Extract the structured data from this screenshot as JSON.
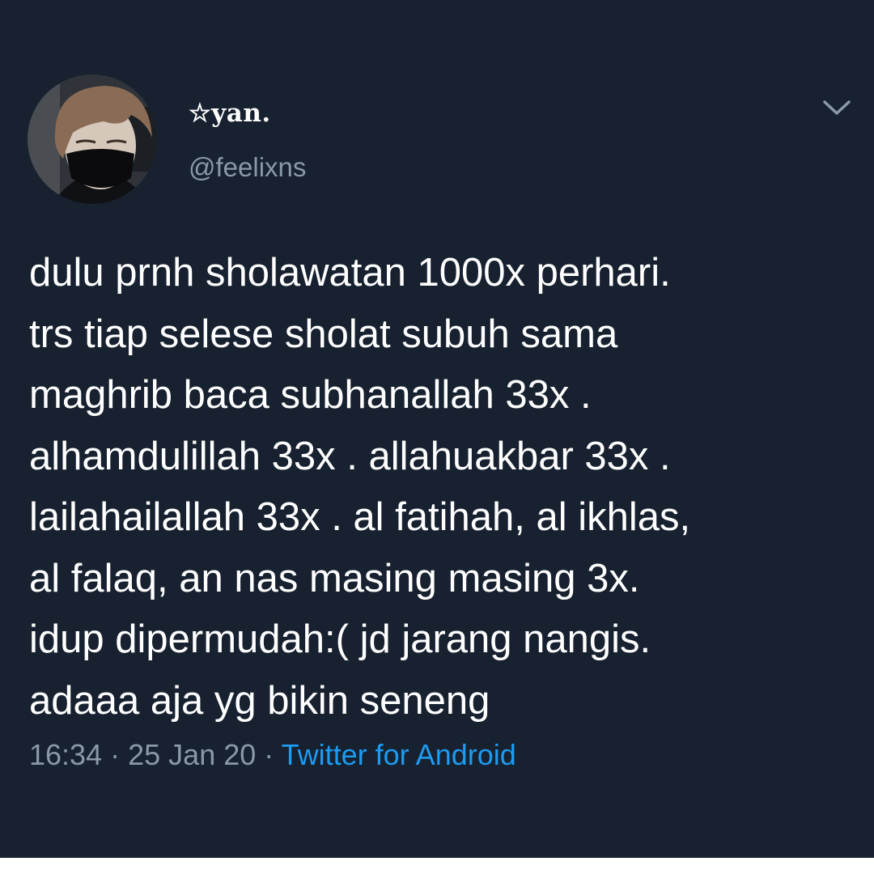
{
  "user": {
    "display_name": "☆yan.",
    "handle": "@feelixns"
  },
  "tweet": {
    "lines": [
      "dulu prnh sholawatan 1000x perhari.",
      "trs tiap selese sholat subuh sama",
      "maghrib baca subhanallah 33x .",
      "alhamdulillah 33x . allahuakbar 33x .",
      "lailahailallah 33x . al fatihah, al ikhlas,",
      "al falaq, an nas masing masing 3x.",
      "idup dipermudah:( jd jarang nangis.",
      "adaaa aja yg bikin seneng"
    ],
    "time": "16:34",
    "separator": "·",
    "date": "25 Jan 20",
    "source": "Twitter for Android"
  },
  "icons": {
    "more": "chevron-down-icon"
  },
  "colors": {
    "background": "#172130",
    "text": "#ffffff",
    "muted": "#8b98a5",
    "link": "#1d9bf0"
  }
}
